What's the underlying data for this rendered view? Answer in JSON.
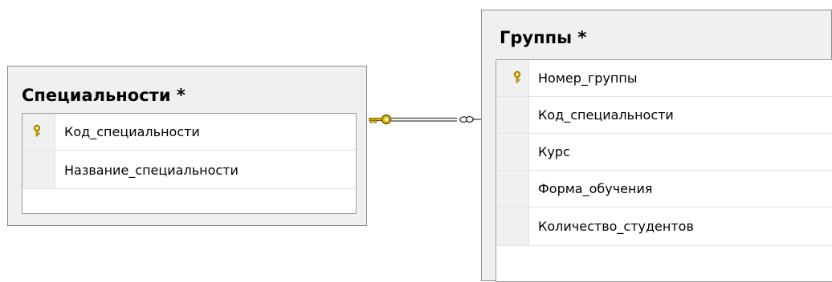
{
  "tables": [
    {
      "title": "Специальности *",
      "columns": [
        {
          "name": "Код_специальности",
          "primary_key": true,
          "icon": "key-icon"
        },
        {
          "name": "Название_специальности",
          "primary_key": false
        }
      ]
    },
    {
      "title": "Группы *",
      "columns": [
        {
          "name": "Номер_группы",
          "primary_key": true,
          "icon": "key-icon"
        },
        {
          "name": "Код_специальности",
          "primary_key": false
        },
        {
          "name": "Курс",
          "primary_key": false
        },
        {
          "name": "Форма_обучения",
          "primary_key": false
        },
        {
          "name": "Количество_студентов",
          "primary_key": false
        }
      ]
    }
  ],
  "relationship": {
    "one_end_icon": "key-icon",
    "many_end_icon": "infinity-icon"
  },
  "colors": {
    "key_gold": "#e8b800",
    "table_frame": "#8a8a8a",
    "table_background": "#f0f0f0"
  }
}
